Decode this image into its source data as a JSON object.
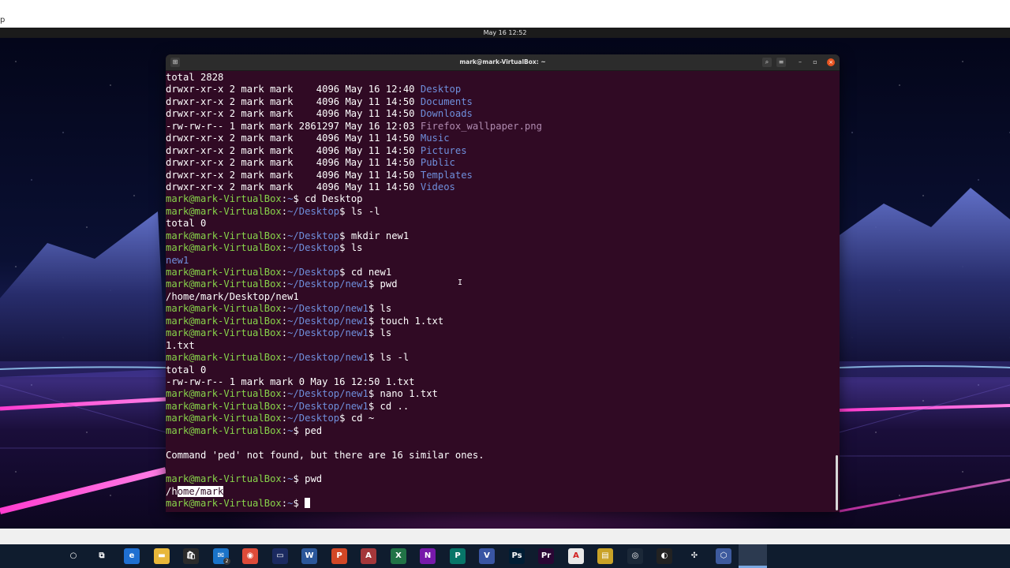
{
  "host": {
    "fragment": "p"
  },
  "topbar": {
    "datetime": "May 16  12:52"
  },
  "terminal": {
    "title": "mark@mark-VirtualBox: ~",
    "buttons": {
      "search": "⌕",
      "menu": "≡",
      "minimize": "–",
      "maximize": "▫",
      "close": "×"
    },
    "prompt_user": "mark@mark-VirtualBox",
    "lines": [
      {
        "t": "plain",
        "text": "total 2828"
      },
      {
        "t": "ls",
        "meta": "drwxr-xr-x 2 mark mark    4096 May 16 12:40 ",
        "name": "Desktop",
        "kind": "dir"
      },
      {
        "t": "ls",
        "meta": "drwxr-xr-x 2 mark mark    4096 May 11 14:50 ",
        "name": "Documents",
        "kind": "dir"
      },
      {
        "t": "ls",
        "meta": "drwxr-xr-x 2 mark mark    4096 May 11 14:50 ",
        "name": "Downloads",
        "kind": "dir"
      },
      {
        "t": "ls",
        "meta": "-rw-rw-r-- 1 mark mark 2861297 May 16 12:03 ",
        "name": "Firefox_wallpaper.png",
        "kind": "file"
      },
      {
        "t": "ls",
        "meta": "drwxr-xr-x 2 mark mark    4096 May 11 14:50 ",
        "name": "Music",
        "kind": "dir"
      },
      {
        "t": "ls",
        "meta": "drwxr-xr-x 2 mark mark    4096 May 11 14:50 ",
        "name": "Pictures",
        "kind": "dir"
      },
      {
        "t": "ls",
        "meta": "drwxr-xr-x 2 mark mark    4096 May 11 14:50 ",
        "name": "Public",
        "kind": "dir"
      },
      {
        "t": "ls",
        "meta": "drwxr-xr-x 2 mark mark    4096 May 11 14:50 ",
        "name": "Templates",
        "kind": "dir"
      },
      {
        "t": "ls",
        "meta": "drwxr-xr-x 2 mark mark    4096 May 11 14:50 ",
        "name": "Videos",
        "kind": "dir"
      },
      {
        "t": "prompt",
        "path": "~",
        "cmd": "cd Desktop"
      },
      {
        "t": "prompt",
        "path": "~/Desktop",
        "cmd": "ls -l"
      },
      {
        "t": "plain",
        "text": "total 0"
      },
      {
        "t": "prompt",
        "path": "~/Desktop",
        "cmd": "mkdir new1"
      },
      {
        "t": "prompt",
        "path": "~/Desktop",
        "cmd": "ls"
      },
      {
        "t": "dirname",
        "text": "new1"
      },
      {
        "t": "prompt",
        "path": "~/Desktop",
        "cmd": "cd new1"
      },
      {
        "t": "prompt",
        "path": "~/Desktop/new1",
        "cmd": "pwd"
      },
      {
        "t": "plain",
        "text": "/home/mark/Desktop/new1"
      },
      {
        "t": "prompt",
        "path": "~/Desktop/new1",
        "cmd": "ls"
      },
      {
        "t": "prompt",
        "path": "~/Desktop/new1",
        "cmd": "touch 1.txt"
      },
      {
        "t": "prompt",
        "path": "~/Desktop/new1",
        "cmd": "ls"
      },
      {
        "t": "plain",
        "text": "1.txt"
      },
      {
        "t": "prompt",
        "path": "~/Desktop/new1",
        "cmd": "ls -l"
      },
      {
        "t": "plain",
        "text": "total 0"
      },
      {
        "t": "plain",
        "text": "-rw-rw-r-- 1 mark mark 0 May 16 12:50 1.txt"
      },
      {
        "t": "prompt",
        "path": "~/Desktop/new1",
        "cmd": "nano 1.txt"
      },
      {
        "t": "prompt",
        "path": "~/Desktop/new1",
        "cmd": "cd .."
      },
      {
        "t": "prompt",
        "path": "~/Desktop",
        "cmd": "cd ~"
      },
      {
        "t": "prompt",
        "path": "~",
        "cmd": "ped"
      },
      {
        "t": "plain",
        "text": ""
      },
      {
        "t": "plain",
        "text": "Command 'ped' not found, but there are 16 similar ones."
      },
      {
        "t": "plain",
        "text": ""
      },
      {
        "t": "prompt",
        "path": "~",
        "cmd": "pwd"
      },
      {
        "t": "selected",
        "pre": "/h",
        "sel": "ome/mark"
      },
      {
        "t": "prompt",
        "path": "~",
        "cmd": "",
        "cursor": true
      }
    ]
  },
  "taskbar": {
    "items": [
      {
        "name": "cortana-icon",
        "glyph": "○",
        "color": "transparent"
      },
      {
        "name": "task-view-icon",
        "glyph": "⧉",
        "color": "transparent"
      },
      {
        "name": "edge-icon",
        "glyph": "e",
        "color": "#1f6fd1"
      },
      {
        "name": "file-explorer-icon",
        "glyph": "▬",
        "color": "#e8b73a"
      },
      {
        "name": "store-icon",
        "glyph": "🛍",
        "color": "#2b2b2b"
      },
      {
        "name": "mail-icon",
        "glyph": "✉",
        "color": "#1a73c8"
      },
      {
        "name": "chrome-icon",
        "glyph": "◉",
        "color": "#dd4b39"
      },
      {
        "name": "video-editor-icon",
        "glyph": "▭",
        "color": "#1b2a60"
      },
      {
        "name": "word-icon",
        "glyph": "W",
        "color": "#2b579a"
      },
      {
        "name": "powerpoint-icon",
        "glyph": "P",
        "color": "#d24726"
      },
      {
        "name": "access-icon",
        "glyph": "A",
        "color": "#a4373a"
      },
      {
        "name": "excel-icon",
        "glyph": "X",
        "color": "#217346"
      },
      {
        "name": "onenote-icon",
        "glyph": "N",
        "color": "#7719aa"
      },
      {
        "name": "publisher-icon",
        "glyph": "P",
        "color": "#077568"
      },
      {
        "name": "visio-icon",
        "glyph": "V",
        "color": "#3955a3"
      },
      {
        "name": "photoshop-icon",
        "glyph": "Ps",
        "color": "#001d34"
      },
      {
        "name": "premiere-icon",
        "glyph": "Pr",
        "color": "#2a0634"
      },
      {
        "name": "acrobat-icon",
        "glyph": "A",
        "color": "#e8e8e8"
      },
      {
        "name": "notes-icon",
        "glyph": "▤",
        "color": "#c9a227"
      },
      {
        "name": "steam-icon",
        "glyph": "◎",
        "color": "#1b2838"
      },
      {
        "name": "obs-icon",
        "glyph": "◐",
        "color": "#222"
      },
      {
        "name": "tools-icon",
        "glyph": "✣",
        "color": "transparent"
      },
      {
        "name": "virtualbox-icon",
        "glyph": "⬡",
        "color": "#3d5a9e"
      },
      {
        "name": "vm-window-icon",
        "glyph": "⚒",
        "color": "#d4a017"
      }
    ],
    "mail_badge": "2"
  }
}
